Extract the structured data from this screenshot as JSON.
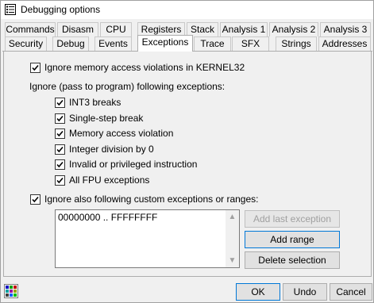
{
  "window": {
    "title": "Debugging options"
  },
  "tabs": {
    "row1": [
      "Commands",
      "Disasm",
      "CPU",
      "Registers",
      "Stack",
      "Analysis 1",
      "Analysis 2",
      "Analysis 3"
    ],
    "row2": [
      "Security",
      "Debug",
      "Events",
      "Exceptions",
      "Trace",
      "SFX",
      "Strings",
      "Addresses"
    ],
    "active": "Exceptions"
  },
  "exceptions": {
    "ignore_kernel32": {
      "label": "Ignore memory access violations in KERNEL32",
      "checked": true
    },
    "ignore_heading": "Ignore (pass to program) following exceptions:",
    "items": [
      {
        "label": "INT3 breaks",
        "checked": true
      },
      {
        "label": "Single-step break",
        "checked": true
      },
      {
        "label": "Memory access violation",
        "checked": true
      },
      {
        "label": "Integer division by 0",
        "checked": true
      },
      {
        "label": "Invalid or privileged instruction",
        "checked": true
      },
      {
        "label": "All FPU exceptions",
        "checked": true
      }
    ],
    "custom": {
      "label": "Ignore also following custom exceptions or ranges:",
      "checked": true
    },
    "ranges_list": [
      "00000000 .. FFFFFFFF"
    ],
    "buttons": {
      "add_last": "Add last exception",
      "add_range": "Add range",
      "delete_selection": "Delete selection"
    }
  },
  "footer": {
    "ok": "OK",
    "undo": "Undo",
    "cancel": "Cancel"
  },
  "colors": {
    "accent": "#0078d7",
    "disabled_text": "#a0a0a0"
  }
}
